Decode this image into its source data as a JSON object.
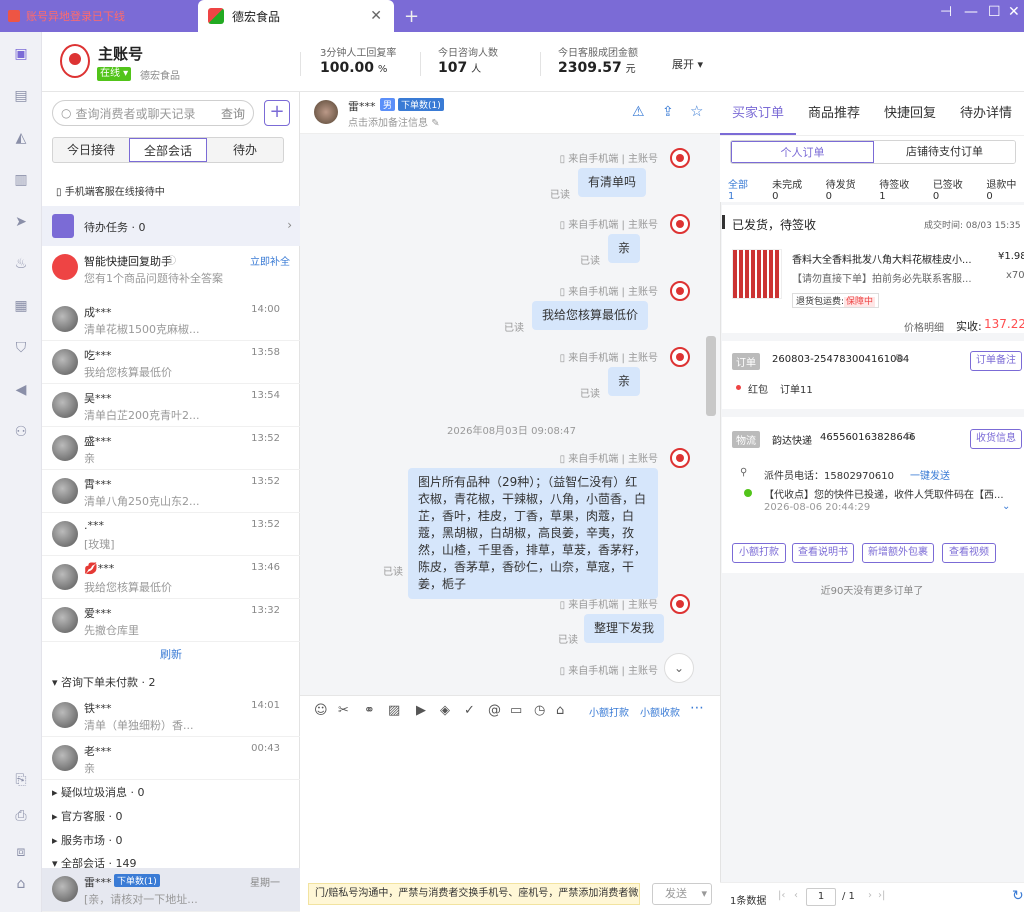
{
  "titlebar": {
    "warning_tab": "账号异地登录已下线",
    "active_tab": "德宏食品",
    "new_tab": "+"
  },
  "header": {
    "account_name": "主账号",
    "status": "在线",
    "shop_name": "德宏食品",
    "stats": [
      {
        "label": "3分钟人工回复率",
        "value": "100.00",
        "unit": "%"
      },
      {
        "label": "今日咨询人数",
        "value": "107",
        "unit": "人"
      },
      {
        "label": "今日客服成团金额",
        "value": "2309.57",
        "unit": "元"
      }
    ],
    "expand": "展开"
  },
  "left": {
    "search_placeholder": "查询消费者或聊天记录",
    "search_btn": "查询",
    "tabs": [
      "今日接待",
      "全部会话",
      "待办"
    ],
    "phone_notice": "手机端客服在线接待中",
    "todo_task": "待办任务 · 0",
    "assistant_title": "智能快捷回复助手",
    "assistant_action": "立即补全",
    "assistant_desc": "您有1个商品问题待补全答案",
    "conversations": [
      {
        "name": "成***",
        "time": "14:00",
        "msg": "清单花椒1500克麻椒..."
      },
      {
        "name": "吃***",
        "time": "13:58",
        "msg": "我给您核算最低价"
      },
      {
        "name": "吴***",
        "time": "13:54",
        "msg": "清单白芷200克青叶2..."
      },
      {
        "name": "盛***",
        "time": "13:52",
        "msg": "亲"
      },
      {
        "name": "霄***",
        "time": "13:52",
        "msg": "清单八角250克山东2..."
      },
      {
        "name": ".***",
        "time": "13:52",
        "msg": "[玫瑰]"
      },
      {
        "name": "💋***",
        "time": "13:46",
        "msg": "我给您核算最低价"
      },
      {
        "name": "爱***",
        "time": "13:32",
        "msg": "先撤仓库里"
      }
    ],
    "refresh": "刷新",
    "group_unpaid": "咨询下单未付款 · 2",
    "unpaid": [
      {
        "name": "铁***",
        "time": "14:01",
        "msg": "清单（单独细粉）香..."
      },
      {
        "name": "老***",
        "time": "00:43",
        "msg": "亲"
      }
    ],
    "groups": [
      "疑似垃圾消息 · 0",
      "官方客服 · 0",
      "服务市场 · 0",
      "全部会话 · 149"
    ],
    "bottom_conv": {
      "name": "雷***",
      "tag": "下单数(1)",
      "time": "星期一",
      "msg": "[亲，请核对一下地址..."
    }
  },
  "chat": {
    "user_name": "雷***",
    "gender": "男",
    "order_tag": "下单数(1)",
    "note_hint": "点击添加备注信息",
    "source": "来自手机端",
    "account": "主账号",
    "read": "已读",
    "messages": [
      "有清单吗",
      "亲",
      "我给您核算最低价",
      "亲"
    ],
    "timestamp": "2026年08月03日 09:08:47",
    "long_message": "图片所有品种（29种）；（益智仁没有）红衣椒，青花椒，干辣椒，八角，小茴香，白芷，香叶，桂皮，丁香，草果，肉蔻，白蔻，黑胡椒，白胡椒，高良姜，辛夷，孜然，山楂，千里香，排草，草茇，香茅籽，陈皮，香茅草，香砂仁，山奈，草寇，干姜，栀子",
    "last_message": "整理下发我",
    "toolbar_links": [
      "小额打款",
      "小额收款"
    ],
    "warning": "门/赔私号沟通中，严禁与消费者交换手机号、座机号，严禁添加消费者微",
    "send": "发送"
  },
  "right": {
    "tabs": [
      "买家订单",
      "商品推荐",
      "快捷回复",
      "待办详情"
    ],
    "subtabs": [
      "个人订单",
      "店铺待支付订单"
    ],
    "filters": [
      "全部 1",
      "未完成 0",
      "待发货 0",
      "待签收 1",
      "已签收 0",
      "退款中 0"
    ],
    "order_status": "已发货，待签收",
    "deal_time": "成交时间: 08/03 15:35",
    "product_title": "香料大全香料批发八角大料花椒桂皮小...",
    "price": "¥1.98",
    "qty": "x70",
    "product_note": "【请勿直接下单】拍前务必先联系客服...",
    "return_tag": "退货包运费:",
    "return_status": "保障中",
    "price_detail": "价格明细",
    "paid_label": "实收:",
    "paid_value": "137.22",
    "order_label": "订单",
    "order_no": "260803-254783004161084",
    "order_note_btn": "订单备注",
    "redpack": "红包",
    "order_count": "订单11",
    "logistics_label": "物流",
    "courier": "韵达快递",
    "tracking_no": "465560163828646",
    "logistics_btn": "收货信息",
    "courier_phone": "派件员电话：15802970610",
    "send_one_click": "一键发送",
    "tracking_event": "【代收点】您的快件已投递，收件人凭取件码在【西...",
    "tracking_time": "2026-08-06 20:44:29",
    "action_btns": [
      "小额打款",
      "查看说明书",
      "新增额外包裹",
      "查看视频"
    ],
    "no_more": "近90天没有更多订单了",
    "footer_count": "1条数据",
    "page": "1",
    "page_total": "/ 1"
  },
  "colors": {
    "accent": "#7b6bd6",
    "bubble": "#d6e6fb",
    "price": "#ff4d4f",
    "online": "#52c41a"
  }
}
